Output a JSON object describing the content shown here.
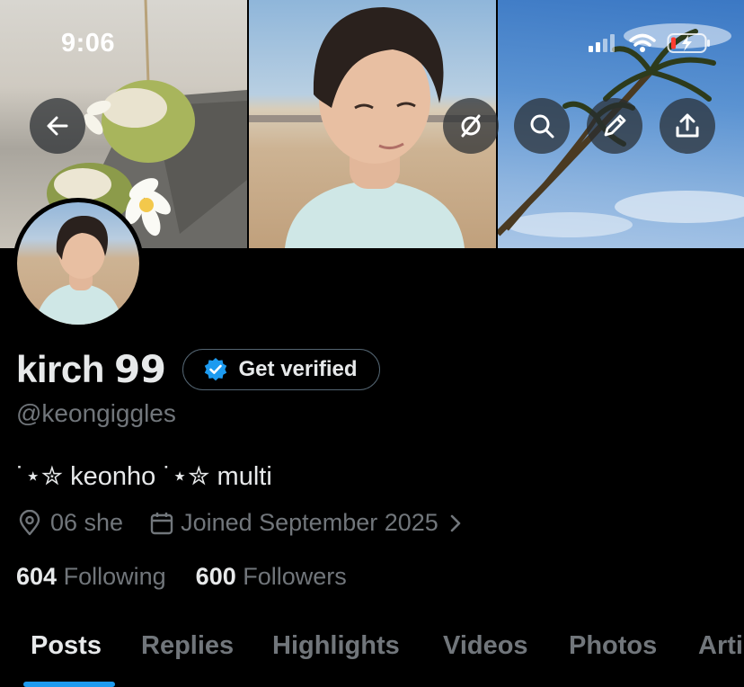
{
  "status_bar": {
    "time": "9:06"
  },
  "header": {
    "buttons": [
      "back-icon",
      "no-signal-icon",
      "search-icon",
      "edit-icon",
      "share-icon"
    ]
  },
  "profile": {
    "display_name": "kirch 𝟵𝟵",
    "get_verified_label": "Get verified",
    "handle": "@keongiggles",
    "bio": "˙⋆✮ keonho ˙⋆✮ multi",
    "location": "06 she",
    "joined": "Joined September 2025",
    "following_count": "604",
    "following_label": "Following",
    "followers_count": "600",
    "followers_label": "Followers"
  },
  "tabs": [
    {
      "label": "Posts",
      "active": true
    },
    {
      "label": "Replies",
      "active": false
    },
    {
      "label": "Highlights",
      "active": false
    },
    {
      "label": "Videos",
      "active": false
    },
    {
      "label": "Photos",
      "active": false
    },
    {
      "label": "Arti",
      "active": false
    }
  ],
  "colors": {
    "accent": "#1d9bf0",
    "muted": "#71767b",
    "text": "#e7e9ea",
    "background": "#000000"
  }
}
